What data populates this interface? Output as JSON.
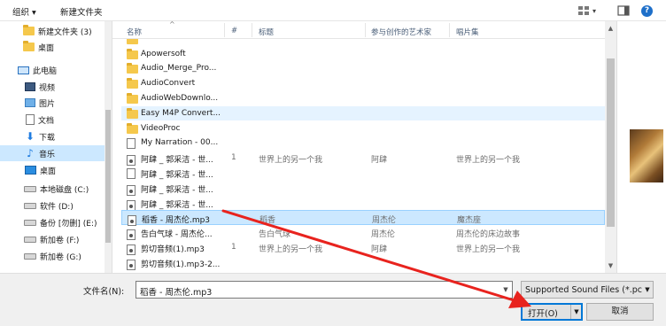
{
  "toolbar": {
    "organize": "组织 ▾",
    "new_folder": "新建文件夹",
    "view_icon": "view-grid-icon",
    "view_drop": "▾",
    "pane_icon": "preview-pane-icon",
    "help_icon": "help-icon",
    "help_glyph": "?"
  },
  "nav": {
    "items": [
      {
        "label": "新建文件夹 (3)",
        "icon": "folder-icon"
      },
      {
        "label": "桌面",
        "icon": "folder-icon"
      },
      {
        "label": "此电脑",
        "icon": "computer-icon"
      },
      {
        "label": "视频",
        "icon": "video-icon"
      },
      {
        "label": "图片",
        "icon": "pictures-icon"
      },
      {
        "label": "文档",
        "icon": "documents-icon"
      },
      {
        "label": "下载",
        "icon": "download-icon"
      },
      {
        "label": "音乐",
        "icon": "music-icon",
        "selected": true
      },
      {
        "label": "桌面",
        "icon": "desktop-icon"
      },
      {
        "label": "本地磁盘 (C:)",
        "icon": "drive-icon"
      },
      {
        "label": "软件 (D:)",
        "icon": "drive-icon"
      },
      {
        "label": "备份 [勿删] (E:)",
        "icon": "drive-icon"
      },
      {
        "label": "新加卷 (F:)",
        "icon": "drive-icon"
      },
      {
        "label": "新加卷 (G:)",
        "icon": "drive-icon"
      }
    ]
  },
  "columns": {
    "name": "名称",
    "number": "#",
    "title": "标题",
    "artist": "参与创作的艺术家",
    "album": "唱片集"
  },
  "files": [
    {
      "name": "Apowersoft",
      "type": "folder",
      "num": "",
      "title": "",
      "artist": "",
      "album": ""
    },
    {
      "name": "Audio_Merge_Pro...",
      "type": "folder",
      "num": "",
      "title": "",
      "artist": "",
      "album": ""
    },
    {
      "name": "AudioConvert",
      "type": "folder",
      "num": "",
      "title": "",
      "artist": "",
      "album": ""
    },
    {
      "name": "AudioWebDownlo...",
      "type": "folder",
      "num": "",
      "title": "",
      "artist": "",
      "album": ""
    },
    {
      "name": "Easy M4P Convert...",
      "type": "folder",
      "num": "",
      "title": "",
      "artist": "",
      "album": "",
      "state": "hover"
    },
    {
      "name": "VideoProc",
      "type": "folder",
      "num": "",
      "title": "",
      "artist": "",
      "album": ""
    },
    {
      "name": "My Narration - 00...",
      "type": "doc",
      "num": "",
      "title": "",
      "artist": "",
      "album": ""
    },
    {
      "name": "阿肆 _ 郭采洁 - 世...",
      "type": "mp3",
      "num": "1",
      "title": "世界上的另一个我",
      "artist": "阿肆",
      "album": "世界上的另一个我"
    },
    {
      "name": "阿肆 _ 郭采洁 - 世...",
      "type": "doc",
      "num": "",
      "title": "",
      "artist": "",
      "album": ""
    },
    {
      "name": "阿肆 _ 郭采洁 - 世...",
      "type": "mp3",
      "num": "",
      "title": "",
      "artist": "",
      "album": ""
    },
    {
      "name": "阿肆 _ 郭采洁 - 世...",
      "type": "mp3",
      "num": "",
      "title": "",
      "artist": "",
      "album": ""
    },
    {
      "name": "稻香 - 周杰伦.mp3",
      "type": "mp3",
      "num": "",
      "title": "稻香",
      "artist": "周杰伦",
      "album": "魔杰座",
      "state": "selected"
    },
    {
      "name": "告白气球 - 周杰伦...",
      "type": "mp3",
      "num": "",
      "title": "告白气球",
      "artist": "周杰伦",
      "album": "周杰伦的床边故事"
    },
    {
      "name": "剪切音频(1).mp3",
      "type": "mp3",
      "num": "1",
      "title": "世界上的另一个我",
      "artist": "阿肆",
      "album": "世界上的另一个我"
    },
    {
      "name": "剪切音频(1).mp3-2...",
      "type": "mp3",
      "num": "",
      "title": "",
      "artist": "",
      "album": ""
    }
  ],
  "bottom": {
    "filename_label": "文件名(N):",
    "filename_value": "稻香 - 周杰伦.mp3",
    "filter_value": "Supported Sound Files (*.pcm",
    "open_label": "打开(O)",
    "cancel_label": "取消"
  },
  "colors": {
    "selection": "#cce8ff",
    "annotation_arrow": "#e8231e",
    "default_button_border": "#0078d7"
  }
}
